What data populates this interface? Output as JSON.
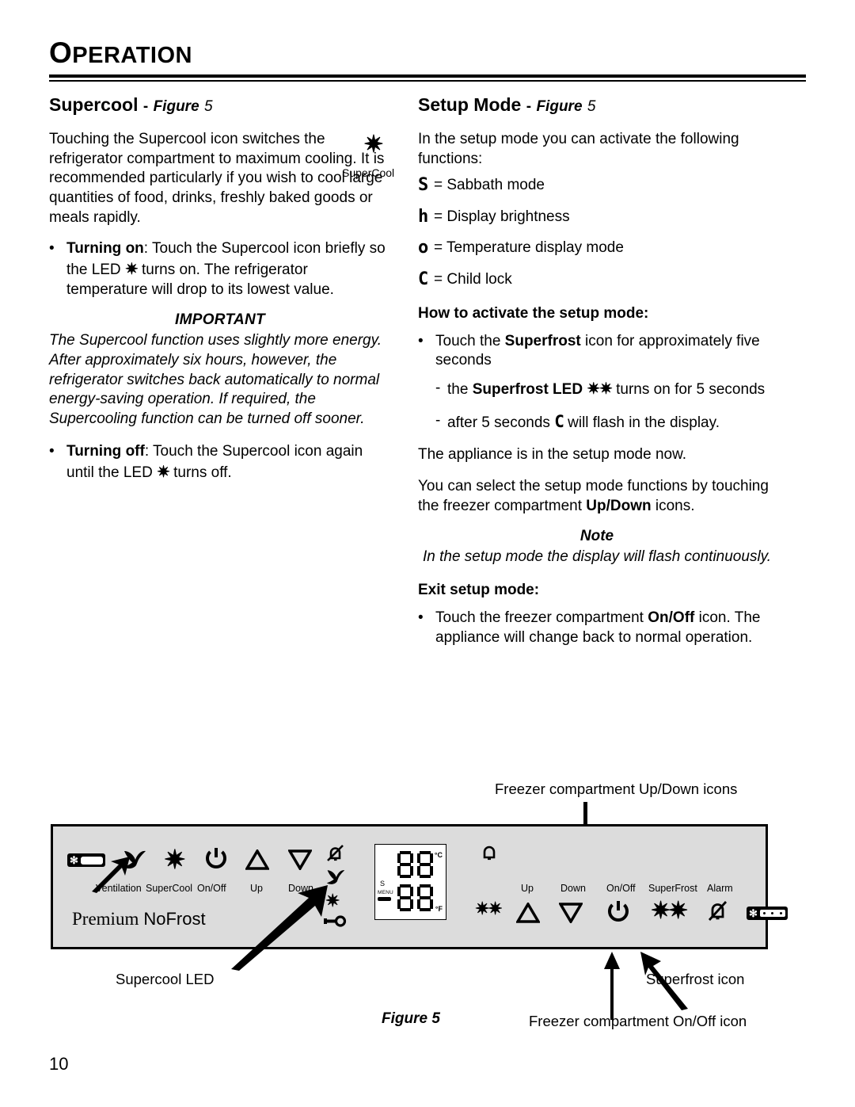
{
  "header": {
    "chapter": "OPERATION",
    "chapter_first": "O",
    "chapter_rest": "PERATION"
  },
  "left_column": {
    "heading": "Supercool",
    "heading_dash": "-",
    "heading_figure_word": "Figure",
    "heading_figure_num": "5",
    "intro": "Touching the Supercool icon switches the refrigerator compartment to maximum cooling. It is recommended particularly if you wish to cool large quantities of food, drinks, freshly baked goods or meals rapidly.",
    "bullet_on_label": "Turning on",
    "bullet_on_text_a": ": Touch the Supercool icon briefly so the LED ",
    "bullet_on_icon": "✷",
    "bullet_on_text_b": " turns on. The refrigerator temperature will drop to its lowest value.",
    "callout_icon": "✷",
    "callout_label": "SuperCool",
    "important_title": "IMPORTANT",
    "important_body": "The Supercool function uses slightly more energy. After approximately six hours, however, the refrigerator switches back automatically to normal energy-saving operation. If required, the Supercooling function can be turned off sooner.",
    "bullet_off_label": "Turning off",
    "bullet_off_text_a": ": Touch the Supercool icon again until the LED ",
    "bullet_off_icon": "✷",
    "bullet_off_text_b": " turns off."
  },
  "right_column": {
    "heading": "Setup Mode",
    "heading_dash": "-",
    "heading_figure_word": "Figure",
    "heading_figure_num": "5",
    "intro": "In the setup mode you can activate the following functions:",
    "functions": [
      {
        "glyph": "S",
        "text": "= Sabbath mode"
      },
      {
        "glyph": "h",
        "text": "= Display brightness"
      },
      {
        "glyph": "o",
        "text": "= Temperature display mode"
      },
      {
        "glyph": "C",
        "text": "= Child lock"
      }
    ],
    "activate_heading": "How to activate the setup mode:",
    "activate_bullet_a": "Touch the ",
    "activate_bullet_bold": "Superfrost",
    "activate_bullet_b": " icon for approximately five seconds",
    "dash1_a": "the ",
    "dash1_bold": "Superfrost LED",
    "dash1_icon": "✷✷",
    "dash1_b": " turns on for 5 seconds",
    "dash2_a": "after 5 seconds ",
    "dash2_glyph": "C",
    "dash2_b": " will flash in the display.",
    "appliance_line": "The appliance is in the setup mode now.",
    "select_a": "You can select the setup mode functions by touching the freezer compartment ",
    "select_bold": "Up/Down",
    "select_b": " icons.",
    "note_title": "Note",
    "note_body": "In the setup mode the display will flash continuously.",
    "exit_heading": "Exit setup mode:",
    "exit_a": "Touch the freezer compartment ",
    "exit_bold": "On/Off",
    "exit_b": " icon. The appliance will change back to normal operation."
  },
  "figure": {
    "caption": "Figure 5",
    "annotations": {
      "top": "Freezer compartment Up/Down icons",
      "supercool_led": "Supercool LED",
      "superfrost_icon": "Superfrost icon",
      "freezer_onoff": "Freezer compartment On/Off icon"
    },
    "brand_primary": "Premium",
    "brand_secondary": "NoFrost",
    "left_controls": [
      {
        "name": "ventilation",
        "label": "Ventilation",
        "icon": "fan-icon"
      },
      {
        "name": "supercool",
        "label": "SuperCool",
        "icon": "asterisk-icon"
      },
      {
        "name": "onoff",
        "label": "On/Off",
        "icon": "power-icon"
      },
      {
        "name": "up",
        "label": "Up",
        "icon": "triangle-up-icon"
      },
      {
        "name": "down",
        "label": "Down",
        "icon": "triangle-down-icon"
      }
    ],
    "left_status_icons": [
      "alarm-off-icon",
      "fan-icon",
      "asterisk-small-icon",
      "key-icon"
    ],
    "right_controls": [
      {
        "name": "up",
        "label": "Up",
        "icon": "triangle-up-icon"
      },
      {
        "name": "down",
        "label": "Down",
        "icon": "triangle-down-icon"
      },
      {
        "name": "onoff",
        "label": "On/Off",
        "icon": "power-icon"
      },
      {
        "name": "superfrost",
        "label": "SuperFrost",
        "icon": "double-asterisk-icon"
      },
      {
        "name": "alarm",
        "label": "Alarm",
        "icon": "alarm-off-icon"
      }
    ],
    "lcd": {
      "unit_top": "°C",
      "unit_bottom": "°F",
      "sabbath_label": "S",
      "menu_label": "MENU",
      "digits_top": "88",
      "digits_bottom": "88"
    },
    "panel_bg": "#dcdcdc",
    "center_icons": [
      "bell-icon",
      "double-asterisk-icon"
    ]
  },
  "footer": {
    "page_number": "10"
  }
}
